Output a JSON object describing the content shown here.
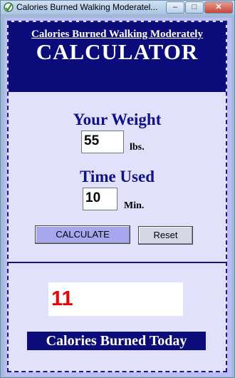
{
  "window": {
    "title": "Calories Burned Walking Moderatel...",
    "minimize_label": "–",
    "maximize_label": "□",
    "close_label": "✕"
  },
  "header": {
    "subtitle": "Calories Burned Walking Moderately",
    "title": "CALCULATOR"
  },
  "weight": {
    "label": "Your Weight",
    "value": "55",
    "unit": "lbs."
  },
  "time": {
    "label": "Time Used",
    "value": "10",
    "unit": "Min."
  },
  "buttons": {
    "calculate": "CALCULATE",
    "reset": "Reset"
  },
  "result": {
    "value": "11",
    "caption": "Calories Burned Today"
  },
  "colors": {
    "header_bg": "#0b0b7a",
    "panel_bg": "#e1e1fb",
    "result_text": "#ee0000"
  }
}
